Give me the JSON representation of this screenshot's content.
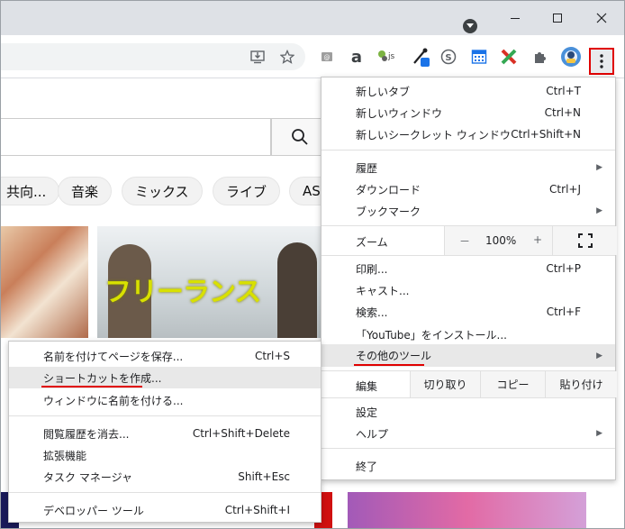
{
  "toolbar": {
    "icons": [
      "install-icon",
      "star-icon",
      "mail-ext-icon",
      "amazon-icon",
      "js-icon",
      "eyedropper-icon",
      "skype-icon",
      "calendar-icon",
      "x-ext-icon",
      "puzzle-icon",
      "profile-avatar",
      "kebab-menu-icon"
    ],
    "amazon_glyph": "a",
    "js_glyph": "js"
  },
  "window": {
    "minimize": "–",
    "maximize": "☐",
    "close": "✕"
  },
  "youtube": {
    "chips": [
      "共向...",
      "音楽",
      "ミックス",
      "ライブ",
      "AS"
    ],
    "thumb2_title": "フリーランス",
    "search_icon": "search-icon"
  },
  "chrome_menu": {
    "new_tab": {
      "label": "新しいタブ",
      "shortcut": "Ctrl+T"
    },
    "new_window": {
      "label": "新しいウィンドウ",
      "shortcut": "Ctrl+N"
    },
    "new_incognito": {
      "label": "新しいシークレット ウィンドウ",
      "shortcut": "Ctrl+Shift+N"
    },
    "history": {
      "label": "履歴"
    },
    "downloads": {
      "label": "ダウンロード",
      "shortcut": "Ctrl+J"
    },
    "bookmarks": {
      "label": "ブックマーク"
    },
    "zoom": {
      "label": "ズーム",
      "minus": "－",
      "value": "100%",
      "plus": "+"
    },
    "print": {
      "label": "印刷...",
      "shortcut": "Ctrl+P"
    },
    "cast": {
      "label": "キャスト..."
    },
    "find": {
      "label": "検索...",
      "shortcut": "Ctrl+F"
    },
    "install": {
      "label": "「YouTube」をインストール..."
    },
    "more_tools": {
      "label": "その他のツール"
    },
    "edit": {
      "label": "編集",
      "cut": "切り取り",
      "copy": "コピー",
      "paste": "貼り付け"
    },
    "settings": {
      "label": "設定"
    },
    "help": {
      "label": "ヘルプ"
    },
    "exit": {
      "label": "終了"
    }
  },
  "submenu": {
    "save_page": {
      "label": "名前を付けてページを保存...",
      "shortcut": "Ctrl+S"
    },
    "create_shortcut": {
      "label": "ショートカットを作成..."
    },
    "name_window": {
      "label": "ウィンドウに名前を付ける..."
    },
    "clear_data": {
      "label": "閲覧履歴を消去...",
      "shortcut": "Ctrl+Shift+Delete"
    },
    "extensions": {
      "label": "拡張機能"
    },
    "task_manager": {
      "label": "タスク マネージャ",
      "shortcut": "Shift+Esc"
    },
    "dev_tools": {
      "label": "デベロッパー ツール",
      "shortcut": "Ctrl+Shift+I"
    }
  },
  "colors": {
    "highlight": "#e00000",
    "titlebar": "#dee1e6",
    "menu_hover": "#e8e8e8"
  }
}
